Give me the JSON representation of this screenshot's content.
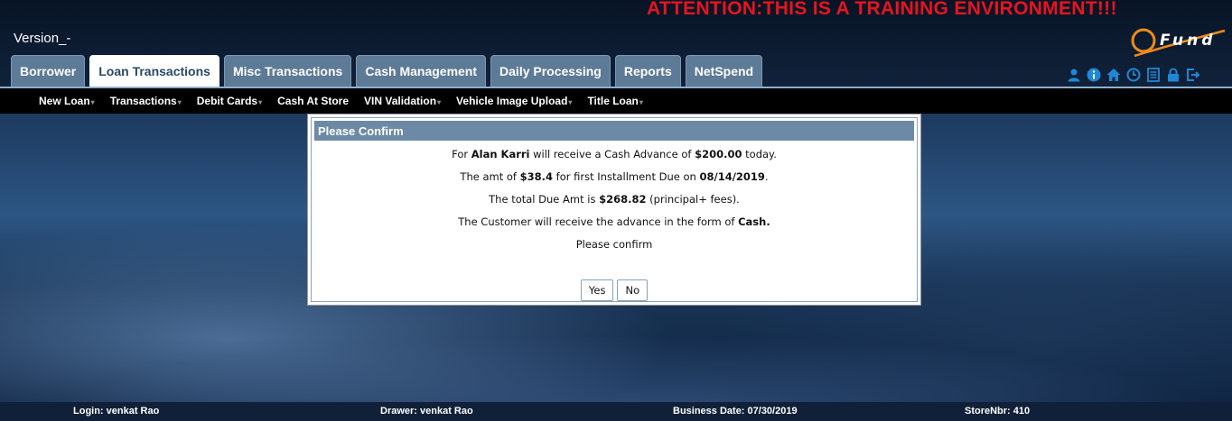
{
  "banner": {
    "attention": "ATTENTION:THIS IS A TRAINING ENVIRONMENT!!!"
  },
  "header": {
    "version": "Version_-",
    "logo_text": "Fund"
  },
  "tabs": [
    {
      "label": "Borrower"
    },
    {
      "label": "Loan Transactions"
    },
    {
      "label": "Misc Transactions"
    },
    {
      "label": "Cash Management"
    },
    {
      "label": "Daily Processing"
    },
    {
      "label": "Reports"
    },
    {
      "label": "NetSpend"
    }
  ],
  "active_tab": "Loan Transactions",
  "toolbar_icons": [
    "user-icon",
    "info-icon",
    "home-icon",
    "clock-icon",
    "notes-icon",
    "lock-icon",
    "logout-icon"
  ],
  "subnav": [
    {
      "label": "New Loan"
    },
    {
      "label": "Transactions"
    },
    {
      "label": "Debit Cards"
    },
    {
      "label": "Cash At Store"
    },
    {
      "label": "VIN Validation"
    },
    {
      "label": "Vehicle Image Upload"
    },
    {
      "label": "Title Loan"
    }
  ],
  "dialog": {
    "title": "Please Confirm",
    "line1": {
      "pre": "For ",
      "name": "Alan  Karri",
      "mid": "  will receive a Cash Advance of ",
      "amount": "$200.00",
      "post": " today."
    },
    "line2": {
      "pre": "The amt of ",
      "amount": "$38.4",
      "mid": " for first Installment Due on ",
      "date": "08/14/2019",
      "post": "."
    },
    "line3": {
      "pre": "The total Due Amt is ",
      "amount": "$268.82",
      "post": " (principal+ fees)."
    },
    "line4": {
      "pre": "The Customer will receive the advance in the form of ",
      "form": "Cash."
    },
    "line5": "Please confirm",
    "yes_label": "Yes",
    "no_label": "No"
  },
  "footer": {
    "login": "Login: venkat Rao",
    "drawer": "Drawer: venkat Rao",
    "business_date": "Business Date: 07/30/2019",
    "store": "StoreNbr: 410"
  },
  "colors": {
    "attention": "#e8141e",
    "tab": "#5d7a96",
    "dialog_title": "#6c8aa6",
    "accent": "#1e88d6"
  }
}
